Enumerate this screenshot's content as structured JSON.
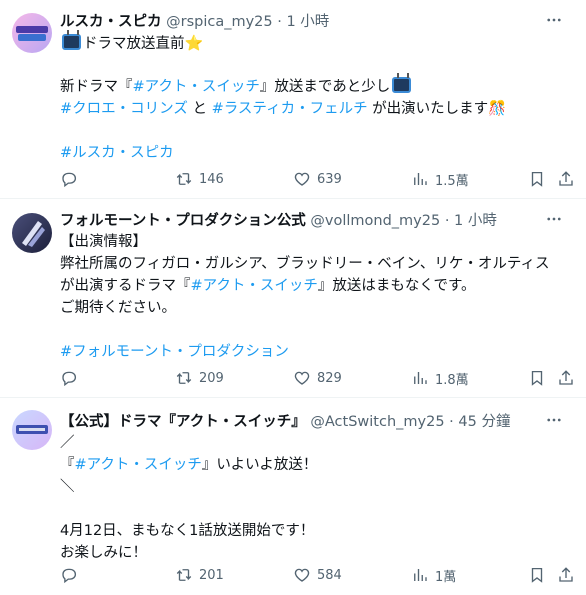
{
  "tweets": [
    {
      "name": "ルスカ・スピカ",
      "handle": "@rspica_my25",
      "sep": "·",
      "time": "1 小時",
      "body_lines": [
        {
          "parts": [
            {
              "t": "",
              "tv": true
            },
            {
              "t": "ドラマ放送直前"
            },
            {
              "t": "⭐",
              "cls": "star"
            }
          ]
        },
        {
          "parts": [
            {
              "t": ""
            }
          ]
        },
        {
          "parts": [
            {
              "t": "新ドラマ『"
            },
            {
              "t": "#アクト・スイッチ",
              "cls": "tag"
            },
            {
              "t": "』放送まであと少し"
            },
            {
              "t": "",
              "tv": true
            }
          ]
        },
        {
          "parts": [
            {
              "t": "#クロエ・コリンズ",
              "cls": "tag"
            },
            {
              "t": " と "
            },
            {
              "t": "#ラスティカ・フェルチ",
              "cls": "tag"
            },
            {
              "t": " が出演いたします"
            },
            {
              "t": "🎊",
              "cls": "party"
            }
          ]
        },
        {
          "parts": [
            {
              "t": ""
            }
          ]
        },
        {
          "parts": [
            {
              "t": "#ルスカ・スピカ",
              "cls": "tag"
            }
          ]
        }
      ],
      "stats": {
        "replies": "",
        "retweets": "146",
        "likes": "639",
        "views": "1.5萬"
      }
    },
    {
      "name": "フォルモーント・プロダクション公式",
      "handle": "@vollmond_my25",
      "sep": "·",
      "time": "1 小時",
      "body_lines": [
        {
          "parts": [
            {
              "t": "【出演情報】"
            }
          ]
        },
        {
          "parts": [
            {
              "t": "弊社所属のフィガロ・ガルシア、ブラッドリー・ベイン、リケ・オルティス"
            }
          ]
        },
        {
          "parts": [
            {
              "t": "が出演するドラマ『"
            },
            {
              "t": "#アクト・スイッチ",
              "cls": "tag"
            },
            {
              "t": "』放送はまもなくです。"
            }
          ]
        },
        {
          "parts": [
            {
              "t": "ご期待ください。"
            }
          ]
        },
        {
          "parts": [
            {
              "t": ""
            }
          ]
        },
        {
          "parts": [
            {
              "t": "#フォルモーント・プロダクション",
              "cls": "tag"
            }
          ]
        }
      ],
      "stats": {
        "replies": "",
        "retweets": "209",
        "likes": "829",
        "views": "1.8萬"
      }
    },
    {
      "name": "【公式】ドラマ『アクト・スイッチ』",
      "handle": "@ActSwitch_my25",
      "sep": "·",
      "time": "45 分鐘",
      "body_lines": [
        {
          "parts": [
            {
              "t": "／"
            }
          ]
        },
        {
          "parts": [
            {
              "t": "『"
            },
            {
              "t": "#アクト・スイッチ",
              "cls": "tag"
            },
            {
              "t": "』いよいよ放送！"
            }
          ]
        },
        {
          "parts": [
            {
              "t": "＼"
            }
          ]
        },
        {
          "parts": [
            {
              "t": ""
            }
          ]
        },
        {
          "parts": [
            {
              "t": "4月12日、まもなく1話放送開始です！"
            }
          ]
        },
        {
          "parts": [
            {
              "t": "お楽しみに！"
            }
          ]
        }
      ],
      "stats": {
        "replies": "",
        "retweets": "201",
        "likes": "584",
        "views": "1萬"
      }
    }
  ],
  "icons": {
    "more": "more-icon",
    "reply": "reply-icon",
    "retweet": "retweet-icon",
    "like": "heart-icon",
    "views": "views-icon",
    "bookmark": "bookmark-icon",
    "share": "share-icon"
  },
  "colors": {
    "accent": "#1d9bf0",
    "muted": "#536471",
    "text": "#0f1419"
  }
}
